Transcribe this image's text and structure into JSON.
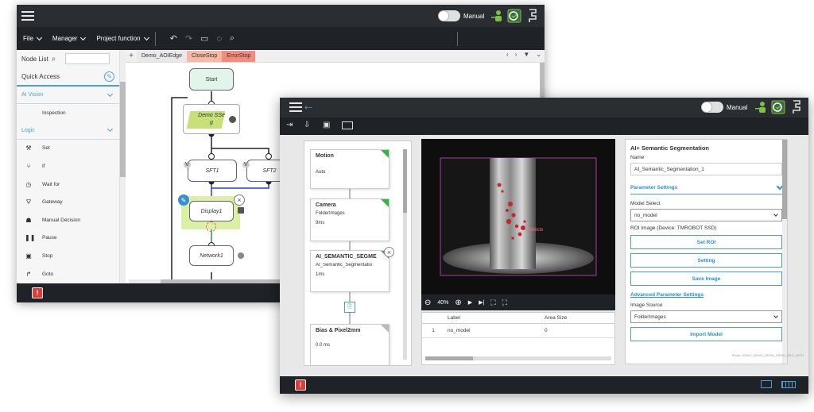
{
  "back_window": {
    "topbar": {
      "mode_label": "Manual"
    },
    "menus": [
      "File",
      "Manager",
      "Project function"
    ],
    "sidebar": {
      "node_list_label": "Node List",
      "quick_access_label": "Quick Access",
      "sections": [
        {
          "label": "AI Vision",
          "items": [
            "Inspection"
          ]
        },
        {
          "label": "Logic",
          "items": [
            "Set",
            "If",
            "Wait for",
            "Gateway",
            "Manual Decision",
            "Pause",
            "Stop",
            "Goto"
          ]
        }
      ]
    },
    "tabs": [
      {
        "label": "Demo_AOIEdge",
        "kind": "main"
      },
      {
        "label": "CloseStop",
        "kind": "close"
      },
      {
        "label": "ErrorStop",
        "kind": "err"
      }
    ],
    "flow": {
      "start": "Start",
      "demo": "Demo SSe\ng",
      "sft1": "SFT1",
      "sft2": "SFT2",
      "display": "Display1",
      "network": "Network1",
      "v_label": "V"
    }
  },
  "front_window": {
    "topbar": {
      "mode_label": "Manual"
    },
    "nodes": [
      {
        "title": "Motion",
        "lines": [
          "",
          "Auto"
        ],
        "corner": "green"
      },
      {
        "title": "Camera",
        "lines": [
          "FolderImages",
          "9ms"
        ],
        "corner": "green"
      },
      {
        "title": "AI_SEMANTIC_SEGME",
        "lines": [
          "AI_Semantic_Segmentatio",
          "1ms"
        ],
        "corner": "green"
      },
      {
        "title": "Bias & Pixel2mm",
        "lines": [
          "",
          "0.0 ms"
        ],
        "corner": "grey"
      }
    ],
    "image": {
      "zoom": "40%",
      "annotation": "defects"
    },
    "table": {
      "columns": [
        "",
        "Label",
        "Area Size"
      ],
      "rows": [
        [
          "1",
          "no_model",
          "0"
        ]
      ]
    },
    "settings": {
      "title": "AI+ Semantic Segmentation",
      "name_label": "Name",
      "name_value": "AI_Semantic_Segmentation_1",
      "param_section": "Parameter Settings",
      "model_label": "Model Select",
      "model_value": "no_model",
      "roi_label": "ROI Image (Device: TMROBOT SSD)",
      "btn_set_roi": "Set ROI",
      "btn_setting": "Setting",
      "btn_save_image": "Save Image",
      "adv_link": "Advanced Parameter Settings",
      "source_label": "Image Source",
      "source_value": "FolderImages",
      "btn_import": "Import Model"
    },
    "footnote": "Photo: DEMO_DEMO_SEGM_DEMO_SEG_WITH"
  },
  "colors": {
    "dark_bar": "#1f2226",
    "accent_blue": "#2a8fd4",
    "node_green": "#35b44a",
    "error_red": "#e53935",
    "defect_overlay": "#c62828"
  }
}
